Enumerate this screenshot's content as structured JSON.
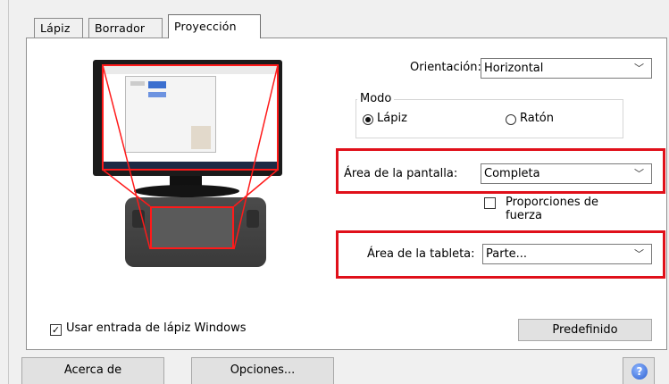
{
  "tabs": [
    {
      "label": "Lápiz"
    },
    {
      "label": "Borrador"
    },
    {
      "label": "Proyección"
    }
  ],
  "orientation": {
    "label": "Orientación:",
    "value": "Horizontal"
  },
  "mode": {
    "title": "Modo",
    "options": [
      {
        "label": "Lápiz",
        "selected": true
      },
      {
        "label": "Ratón",
        "selected": false
      }
    ]
  },
  "screen_area": {
    "label": "Área de la pantalla:",
    "value": "Completa"
  },
  "force_proportions": {
    "label_line1": "Proporciones de",
    "label_line2": "fuerza",
    "checked": false
  },
  "tablet_area": {
    "label": "Área de la tableta:",
    "value": "Parte..."
  },
  "windows_ink": {
    "label": "Usar entrada de lápiz Windows",
    "checked": true,
    "mark": "✓"
  },
  "buttons": {
    "default": "Predefinido",
    "about": "Acerca de",
    "options": "Opciones..."
  },
  "icons": {
    "chevron": "﹀",
    "help": "?"
  },
  "highlight_color": "#e0101a"
}
